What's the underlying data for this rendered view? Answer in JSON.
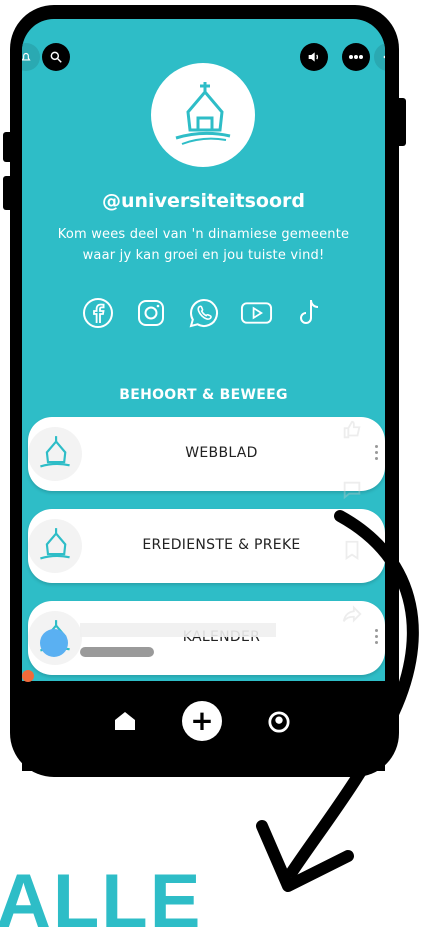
{
  "profile": {
    "handle": "@universiteitsoord",
    "bio_line1": "Kom wees deel van 'n dinamiese gemeente",
    "bio_line2": "waar jy kan groei en jou tuiste vind!"
  },
  "social_icons": [
    "facebook-icon",
    "instagram-icon",
    "whatsapp-icon",
    "youtube-icon",
    "tiktok-icon"
  ],
  "section": {
    "title": "BEHOORT & BEWEEG"
  },
  "links": [
    {
      "label": "WEBBLAD"
    },
    {
      "label": "EREDIENSTE & PREKE"
    },
    {
      "label": "KALENDER"
    }
  ],
  "overlay_text": "ALLE",
  "colors": {
    "teal": "#2ebdc7",
    "black": "#000000",
    "white": "#ffffff",
    "orange": "#f26a3a"
  }
}
